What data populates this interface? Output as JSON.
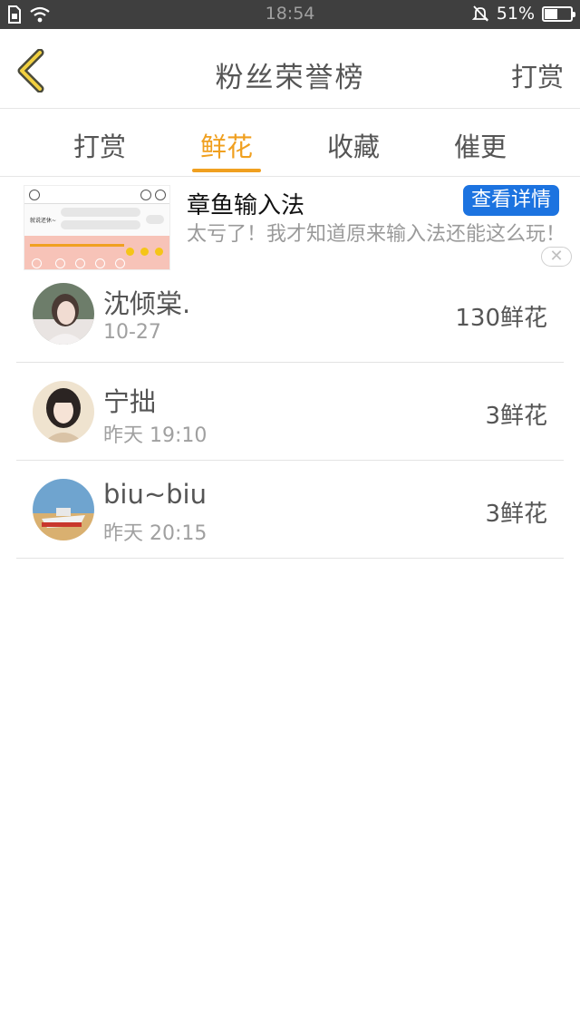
{
  "status_bar": {
    "time": "18:54",
    "battery": "51%",
    "battery_level": 0.51
  },
  "header": {
    "title": "粉丝荣誉榜",
    "right_button": "打赏"
  },
  "tabs": [
    {
      "label": "打赏",
      "active": false
    },
    {
      "label": "鲜花",
      "active": true
    },
    {
      "label": "收藏",
      "active": false
    },
    {
      "label": "催更",
      "active": false
    }
  ],
  "ad": {
    "title": "章鱼输入法",
    "button": "查看详情",
    "description": "太亏了！我才知道原来输入法还能这么玩！",
    "thumb_text": "就说还休~"
  },
  "fans": [
    {
      "name": "沈倾棠.",
      "time": "10-27",
      "flowers": "130鲜花"
    },
    {
      "name": "宁拙",
      "time": "昨天 19:10",
      "flowers": "3鲜花"
    },
    {
      "name": "biu~biu",
      "time": "昨天 20:15",
      "flowers": "3鲜花"
    }
  ],
  "colors": {
    "accent": "#f0a020",
    "ad_button": "#1c73e0",
    "status_bar": "#3f3f3f"
  }
}
